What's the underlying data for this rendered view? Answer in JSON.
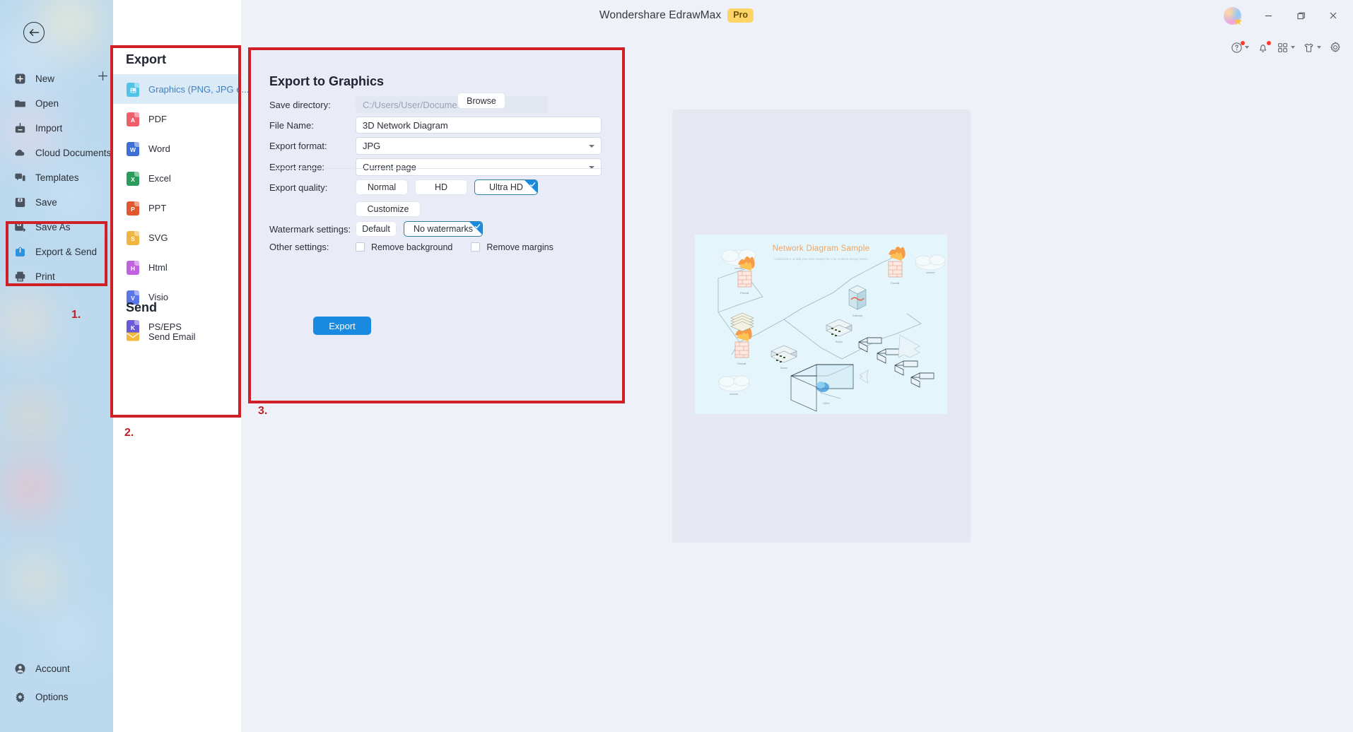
{
  "window": {
    "app_title": "Wondershare EdrawMax",
    "pro_badge": "Pro",
    "controls": {
      "minimize": "minimize-icon",
      "maximize": "restore-icon",
      "close": "close-icon"
    },
    "avatar": "user-avatar"
  },
  "toolbar_icons": [
    {
      "name": "help-icon",
      "has_dot": true,
      "has_caret": true
    },
    {
      "name": "notification-bell-icon",
      "has_dot": true,
      "has_caret": false
    },
    {
      "name": "apps-grid-icon",
      "has_dot": false,
      "has_caret": true
    },
    {
      "name": "theme-shirt-icon",
      "has_dot": false,
      "has_caret": true
    },
    {
      "name": "settings-gear-icon",
      "has_dot": false,
      "has_caret": false
    }
  ],
  "sidebar": {
    "back_button": "back-arrow",
    "add_button": "plus-icon",
    "items": [
      {
        "label": "New",
        "icon": "new-file-icon"
      },
      {
        "label": "Open",
        "icon": "folder-open-icon"
      },
      {
        "label": "Import",
        "icon": "import-icon"
      },
      {
        "label": "Cloud Documents",
        "icon": "cloud-icon"
      },
      {
        "label": "Templates",
        "icon": "templates-icon"
      },
      {
        "label": "Save",
        "icon": "save-disk-icon"
      },
      {
        "label": "Save As",
        "icon": "save-as-icon"
      },
      {
        "label": "Export & Send",
        "icon": "export-send-icon"
      },
      {
        "label": "Print",
        "icon": "printer-icon"
      }
    ],
    "bottom_items": [
      {
        "label": "Account",
        "icon": "account-icon"
      },
      {
        "label": "Options",
        "icon": "options-gear-icon"
      }
    ]
  },
  "export_panel": {
    "export_heading": "Export",
    "send_heading": "Send",
    "items": [
      {
        "label": "Graphics (PNG, JPG e...",
        "icon": "graphics-file-icon",
        "color": "#4fc3e8",
        "glyph": "",
        "selected": true
      },
      {
        "label": "PDF",
        "icon": "pdf-file-icon",
        "color": "#ef5e6a",
        "glyph": "A",
        "selected": false
      },
      {
        "label": "Word",
        "icon": "word-file-icon",
        "color": "#3d6fd6",
        "glyph": "W",
        "selected": false
      },
      {
        "label": "Excel",
        "icon": "excel-file-icon",
        "color": "#2a9d5c",
        "glyph": "X",
        "selected": false
      },
      {
        "label": "PPT",
        "icon": "ppt-file-icon",
        "color": "#e2582e",
        "glyph": "P",
        "selected": false
      },
      {
        "label": "SVG",
        "icon": "svg-file-icon",
        "color": "#f0b440",
        "glyph": "S",
        "selected": false
      },
      {
        "label": "Html",
        "icon": "html-file-icon",
        "color": "#c062e0",
        "glyph": "H",
        "selected": false
      },
      {
        "label": "Visio",
        "icon": "visio-file-icon",
        "color": "#5b76e8",
        "glyph": "V",
        "selected": false
      },
      {
        "label": "PS/EPS",
        "icon": "pseps-file-icon",
        "color": "#6a5ad8",
        "glyph": "K",
        "selected": false
      }
    ],
    "send_items": [
      {
        "label": "Send Email",
        "icon": "email-icon",
        "color": "#f2b93c"
      }
    ]
  },
  "form": {
    "title": "Export to Graphics",
    "save_directory": {
      "label": "Save directory:",
      "placeholder": "C:/Users/User/Documents",
      "value": ""
    },
    "browse_button": "Browse",
    "file_name": {
      "label": "File Name:",
      "value": "3D Network Diagram"
    },
    "export_format": {
      "label": "Export format:",
      "value": "JPG"
    },
    "export_range": {
      "label": "Export range:",
      "value": "Current page"
    },
    "export_quality": {
      "label": "Export quality:",
      "options": [
        {
          "label": "Normal",
          "selected": false
        },
        {
          "label": "HD",
          "selected": false
        },
        {
          "label": "Ultra HD",
          "selected": true
        },
        {
          "label": "Customize",
          "selected": false
        }
      ]
    },
    "watermark_settings": {
      "label": "Watermark settings:",
      "options": [
        {
          "label": "Default",
          "selected": false
        },
        {
          "label": "No watermarks",
          "selected": true
        }
      ]
    },
    "other_settings": {
      "label": "Other settings:",
      "checkboxes": [
        {
          "label": "Remove background",
          "checked": false
        },
        {
          "label": "Remove margins",
          "checked": false
        }
      ]
    },
    "export_button": "Export"
  },
  "preview": {
    "title": "Network Diagram Sample",
    "subtitle": "Customize it or add your own shapes for your network design needs"
  },
  "annotations": [
    {
      "label": "1."
    },
    {
      "label": "2."
    },
    {
      "label": "3."
    }
  ],
  "colors": {
    "accent_blue": "#1a8ae0",
    "annotation_red": "#cf2027",
    "sidebar_bg": "#bcd9ee",
    "panel_bg": "#e9ecf6",
    "selected_item_bg": "#dbeaf7",
    "badge_yellow": "#ffd466"
  }
}
